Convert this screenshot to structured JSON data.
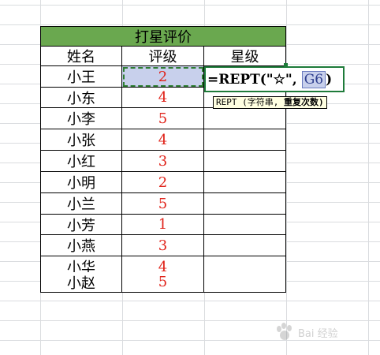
{
  "table": {
    "title": "打星评价",
    "headers": {
      "name": "姓名",
      "rating": "评级",
      "stars": "星级"
    },
    "rows": [
      {
        "name": "小王",
        "rating": "2"
      },
      {
        "name": "小东",
        "rating": "4"
      },
      {
        "name": "小李",
        "rating": "5"
      },
      {
        "name": "小张",
        "rating": "4"
      },
      {
        "name": "小红",
        "rating": "3"
      },
      {
        "name": "小明",
        "rating": "2"
      },
      {
        "name": "小兰",
        "rating": "5"
      },
      {
        "name": "小芳",
        "rating": "1"
      },
      {
        "name": "小燕",
        "rating": "3"
      },
      {
        "name": "小华",
        "rating": "4"
      },
      {
        "name": "小赵",
        "rating": "5"
      }
    ]
  },
  "formula": {
    "prefix": "=REPT(\"☆\",",
    "ref": "G6",
    "suffix": ")"
  },
  "tooltip": {
    "fn": "REPT",
    "arg1": "(字符串,",
    "arg2": "重复次数)"
  },
  "watermark": {
    "text": "Bai 经验"
  },
  "colors": {
    "title_bg": "#6aa84f",
    "rating_text": "#e0231a",
    "selection_bg": "#c8d0ec",
    "active_border": "#1e7b3a"
  }
}
